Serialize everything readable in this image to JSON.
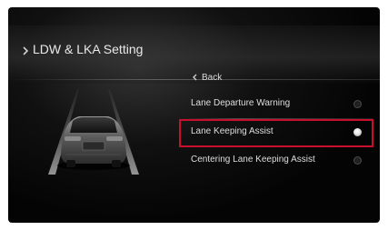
{
  "header": {
    "title": "LDW & LKA Setting",
    "chevron_icon": "chevron-right-icon"
  },
  "back": {
    "label": "Back",
    "icon": "chevron-left-icon"
  },
  "menu": {
    "items": [
      {
        "label": "Lane Departure Warning",
        "selected": false
      },
      {
        "label": "Lane Keeping Assist",
        "selected": true
      },
      {
        "label": "Centering Lane Keeping Assist",
        "selected": false
      }
    ]
  },
  "colors": {
    "background": "#040404",
    "text": "#e9e9e9",
    "selection_border": "#c8102e"
  }
}
